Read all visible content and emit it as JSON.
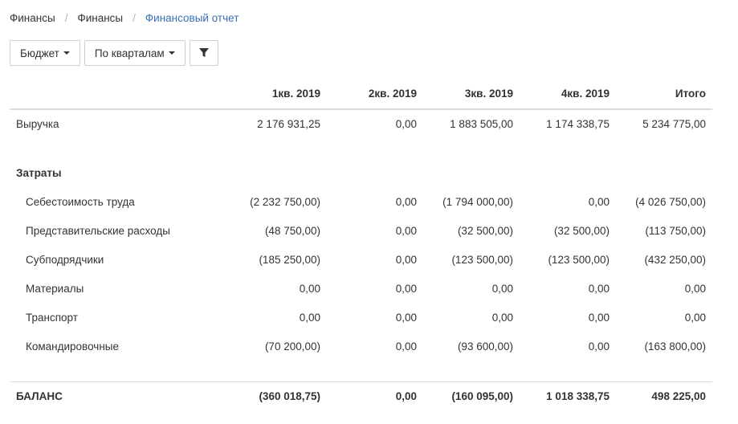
{
  "breadcrumb": [
    "Финансы",
    "Финансы",
    "Финансовый отчет"
  ],
  "toolbar": {
    "budget_label": "Бюджет",
    "period_label": "По кварталам",
    "filter_icon": "filter-icon"
  },
  "table": {
    "columns": [
      "1кв. 2019",
      "2кв. 2019",
      "3кв. 2019",
      "4кв. 2019",
      "Итого"
    ],
    "revenue": {
      "label": "Выручка",
      "values": [
        "2 176 931,25",
        "0,00",
        "1 883 505,00",
        "1 174 338,75",
        "5 234 775,00"
      ]
    },
    "expenses_title": "Затраты",
    "expenses": [
      {
        "label": "Себестоимость труда",
        "values": [
          "(2 232 750,00)",
          "0,00",
          "(1 794 000,00)",
          "0,00",
          "(4 026 750,00)"
        ]
      },
      {
        "label": "Представительские расходы",
        "values": [
          "(48 750,00)",
          "0,00",
          "(32 500,00)",
          "(32 500,00)",
          "(113 750,00)"
        ]
      },
      {
        "label": "Субподрядчики",
        "values": [
          "(185 250,00)",
          "0,00",
          "(123 500,00)",
          "(123 500,00)",
          "(432 250,00)"
        ]
      },
      {
        "label": "Материалы",
        "values": [
          "0,00",
          "0,00",
          "0,00",
          "0,00",
          "0,00"
        ]
      },
      {
        "label": "Транспорт",
        "values": [
          "0,00",
          "0,00",
          "0,00",
          "0,00",
          "0,00"
        ]
      },
      {
        "label": "Командировочные",
        "values": [
          "(70 200,00)",
          "0,00",
          "(93 600,00)",
          "0,00",
          "(163 800,00)"
        ]
      }
    ],
    "balance": {
      "label": "БАЛАНС",
      "values": [
        "(360 018,75)",
        "0,00",
        "(160 095,00)",
        "1 018 338,75",
        "498 225,00"
      ]
    }
  }
}
